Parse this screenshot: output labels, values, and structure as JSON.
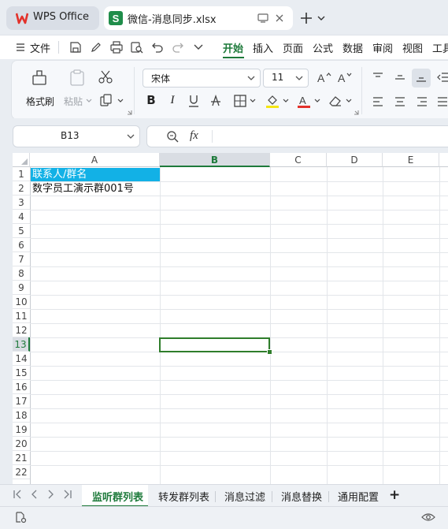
{
  "app": {
    "wps_tab_label": "WPS Office",
    "file_tab_label": "微信-消息同步.xlsx"
  },
  "menu": {
    "file": "文件",
    "items": [
      "开始",
      "插入",
      "页面",
      "公式",
      "数据",
      "审阅",
      "视图",
      "工具"
    ],
    "active": "开始"
  },
  "ribbon": {
    "format_painter": "格式刷",
    "paste": "粘贴",
    "font_name": "宋体",
    "font_size": "11"
  },
  "formula_bar": {
    "cell_ref": "B13",
    "fx_label": "fx",
    "content": ""
  },
  "sheet": {
    "columns": [
      "A",
      "B",
      "C",
      "D",
      "E"
    ],
    "selected_column": "B",
    "rows": [
      "1",
      "2",
      "3",
      "4",
      "5",
      "6",
      "7",
      "8",
      "9",
      "10",
      "11",
      "12",
      "13",
      "14",
      "15",
      "16",
      "17",
      "18",
      "19",
      "20",
      "21",
      "22"
    ],
    "selected_row": "13",
    "cells": {
      "A1": "联系人/群名",
      "A2": "数字员工演示群001号"
    },
    "header_fill_color": "#12b1e6"
  },
  "sheet_tabs": {
    "tabs": [
      "监听群列表",
      "转发群列表",
      "消息过滤",
      "消息替换",
      "通用配置"
    ],
    "active": "监听群列表",
    "add_label": "+"
  },
  "colors": {
    "accent": "#1e7a3b",
    "wps_red": "#e3322b",
    "sheets_green": "#1f8d4a"
  }
}
